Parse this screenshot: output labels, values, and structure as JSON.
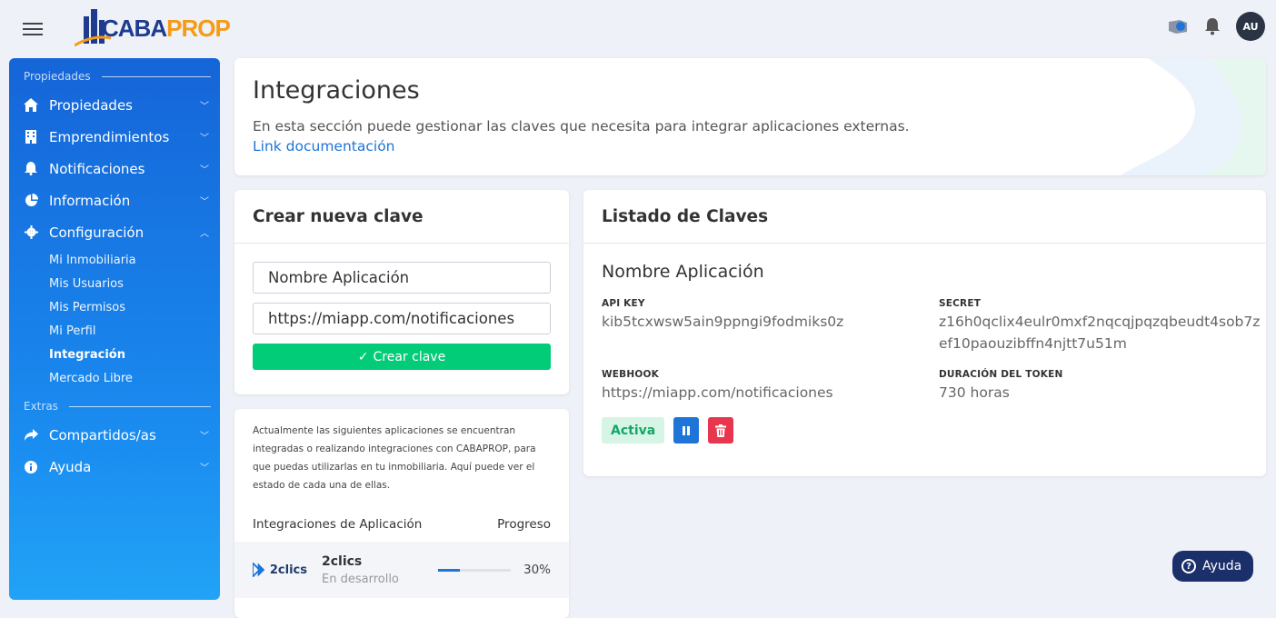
{
  "header": {
    "logo_part1": "CABA",
    "logo_part2": "PROP",
    "avatar_initials": "AU"
  },
  "sidebar": {
    "section1_title": "Propiedades",
    "items": [
      {
        "label": "Propiedades",
        "icon": "home-icon"
      },
      {
        "label": "Emprendimientos",
        "icon": "building-icon"
      },
      {
        "label": "Notificaciones",
        "icon": "bell-icon"
      },
      {
        "label": "Información",
        "icon": "pie-chart-icon"
      },
      {
        "label": "Configuración",
        "icon": "gear-icon"
      }
    ],
    "sub_items": [
      "Mi Inmobiliaria",
      "Mis Usuarios",
      "Mis Permisos",
      "Mi Perfil",
      "Integración",
      "Mercado Libre"
    ],
    "active_sub": "Integración",
    "section2_title": "Extras",
    "extras": [
      {
        "label": "Compartidos/as",
        "icon": "share-icon"
      },
      {
        "label": "Ayuda",
        "icon": "info-icon"
      }
    ]
  },
  "hero": {
    "title": "Integraciones",
    "description": "En esta sección puede gestionar las claves que necesita para integrar aplicaciones externas.",
    "link": "Link documentación"
  },
  "create_key": {
    "title": "Crear nueva clave",
    "app_name_value": "Nombre Aplicación",
    "webhook_value": "https://miapp.com/notificaciones",
    "button_label": "Crear clave"
  },
  "apps": {
    "description": "Actualmente las siguientes aplicaciones se encuentran integradas o realizando integraciones con CABAPROP, para que puedas utilizarlas en tu inmobiliaria. Aquí puede ver el estado de cada una de ellas.",
    "col_app": "Integraciones de Aplicación",
    "col_progress": "Progreso",
    "rows": [
      {
        "logo_text": "2clics",
        "name": "2clics",
        "status": "En desarrollo",
        "progress": 30,
        "progress_label": "30%"
      }
    ]
  },
  "keys": {
    "title": "Listado de Claves",
    "app_name": "Nombre Aplicación",
    "api_key_label": "API KEY",
    "api_key": "kib5tcxwsw5ain9ppngi9fodmiks0z",
    "secret_label": "SECRET",
    "secret_line1": "z16h0qclix4eulr0mxf2nqcqjpqzqbeudt4sob7z",
    "secret_line2": "ef10paouzibffn4njtt7u51m",
    "webhook_label": "WEBHOOK",
    "webhook": "https://miapp.com/notificaciones",
    "duration_label": "DURACIÓN DEL TOKEN",
    "duration": "730 horas",
    "status_badge": "Activa"
  },
  "help_button": "Ayuda",
  "colors": {
    "accent": "#1f74d8",
    "success": "#02cc78",
    "danger": "#e8364f",
    "sidebar": "#1565d8"
  }
}
